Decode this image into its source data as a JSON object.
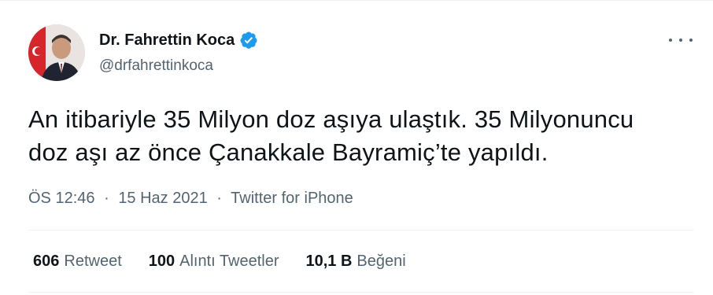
{
  "author": {
    "name": "Dr. Fahrettin Koca",
    "handle": "@drfahrettinkoca",
    "verified": true,
    "avatar_icon": "profile-photo"
  },
  "tweet": {
    "text": "An itibariyle 35 Milyon doz aşıya ulaştık. 35 Milyonuncu\ndoz aşı az önce Çanakkale Bayramiç’te yapıldı.",
    "time": "ÖS 12:46",
    "separator": "·",
    "date": "15 Haz 2021",
    "source": "Twitter for iPhone"
  },
  "stats": {
    "retweets_count": "606",
    "retweets_label": "Retweet",
    "quotes_count": "100",
    "quotes_label": "Alıntı Tweetler",
    "likes_count": "10,1 B",
    "likes_label": "Beğeni"
  },
  "colors": {
    "verified_blue": "#1d9bf0",
    "secondary_text": "#536471",
    "primary_text": "#0f1419"
  }
}
